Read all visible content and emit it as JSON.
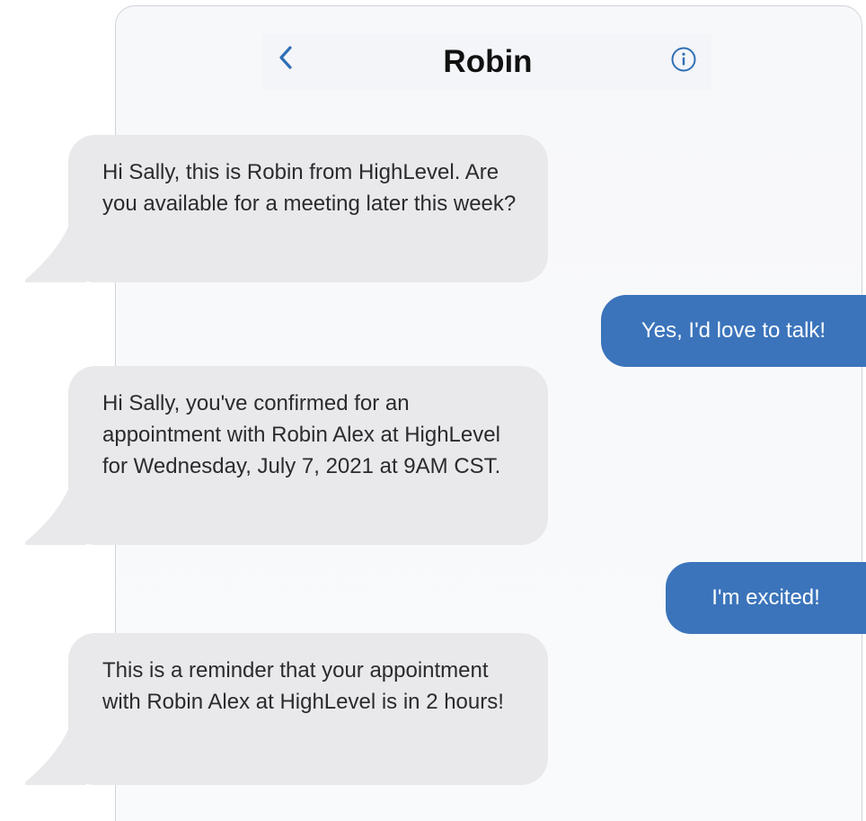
{
  "header": {
    "title": "Robin",
    "back_icon": "chevron-left-icon",
    "info_icon": "info-circle-icon"
  },
  "messages": [
    {
      "direction": "incoming",
      "text": "Hi Sally, this is Robin from HighLevel. Are you available for a meeting later this week?"
    },
    {
      "direction": "outgoing",
      "text": "Yes, I'd love to talk!"
    },
    {
      "direction": "incoming",
      "text": "Hi Sally, you've confirmed for an appointment with Robin Alex at HighLevel for Wednesday, July 7, 2021 at 9AM CST."
    },
    {
      "direction": "outgoing",
      "text": "I'm excited!"
    },
    {
      "direction": "incoming",
      "text": "This is a reminder that your appointment with Robin Alex at HighLevel is in 2 hours!"
    }
  ],
  "colors": {
    "incoming_bubble": "#e9e9ec",
    "outgoing_bubble": "#3b74bb",
    "accent": "#2f6fb5"
  }
}
